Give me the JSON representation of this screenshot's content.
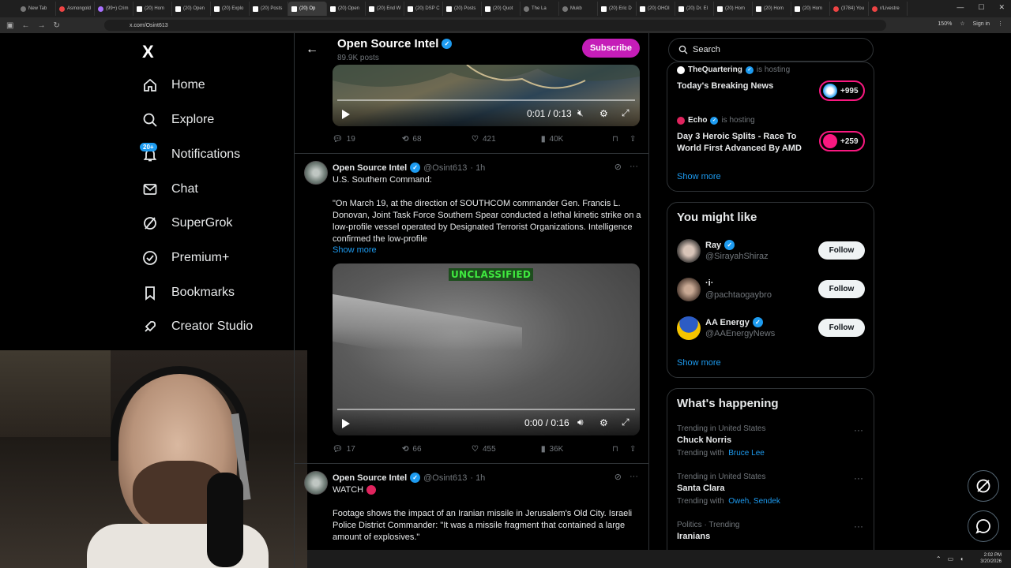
{
  "browser": {
    "tabs": [
      {
        "label": "New Tab",
        "fav": "g"
      },
      {
        "label": "Asmongold",
        "fav": "r"
      },
      {
        "label": "(99+) Crim",
        "fav": "p"
      },
      {
        "label": "(20) Hom",
        "fav": "x"
      },
      {
        "label": "(20) Open",
        "fav": "x"
      },
      {
        "label": "(20) Explo",
        "fav": "x"
      },
      {
        "label": "(20) Posts",
        "fav": "x"
      },
      {
        "label": "(20) Op",
        "fav": "x",
        "active": true
      },
      {
        "label": "(20) Open",
        "fav": "x"
      },
      {
        "label": "(20) End W",
        "fav": "x"
      },
      {
        "label": "(20) DSP C",
        "fav": "x"
      },
      {
        "label": "(20) Posts",
        "fav": "x"
      },
      {
        "label": "(20) Quot",
        "fav": "x"
      },
      {
        "label": "The La",
        "fav": "g"
      },
      {
        "label": "Mukb",
        "fav": "g"
      },
      {
        "label": "(20) Eric D",
        "fav": "x"
      },
      {
        "label": "(20) OHOI",
        "fav": "x"
      },
      {
        "label": "(20) Dr. El",
        "fav": "x"
      },
      {
        "label": "(20) Hom",
        "fav": "x"
      },
      {
        "label": "(20) Hom",
        "fav": "x"
      },
      {
        "label": "(20) Hom",
        "fav": "x"
      },
      {
        "label": "(3784) You",
        "fav": "r"
      },
      {
        "label": "r/Livestre",
        "fav": "r"
      }
    ],
    "url": "x.com/Osint613",
    "zoom": "150%",
    "signin": "Sign in"
  },
  "sidebar": {
    "logo": "X",
    "items": [
      {
        "label": "Home"
      },
      {
        "label": "Explore"
      },
      {
        "label": "Notifications"
      },
      {
        "label": "Chat"
      },
      {
        "label": "SuperGrok"
      },
      {
        "label": "Premium+"
      },
      {
        "label": "Bookmarks"
      },
      {
        "label": "Creator Studio"
      }
    ],
    "notif_badge": "20+"
  },
  "profile_header": {
    "name": "Open Source Intel",
    "posts": "89.9K posts",
    "subscribe": "Subscribe"
  },
  "video1": {
    "time": "0:01 / 0:13"
  },
  "tweet0_actions": {
    "replies": "19",
    "reposts": "68",
    "likes": "421",
    "views": "40K"
  },
  "tweet1": {
    "name": "Open Source Intel",
    "handle": "@Osint613",
    "time": "· 1h",
    "line1": "U.S. Southern Command:",
    "body": "\"On March 19, at the direction of SOUTHCOM commander Gen. Francis L. Donovan, Joint Task Force Southern Spear conducted a lethal kinetic strike on a low-profile vessel operated by Designated Terrorist Organizations. Intelligence confirmed the low-profile",
    "show_more": "Show more",
    "video_label": "UNCLASSIFIED",
    "video_time": "0:00 / 0:16",
    "replies": "17",
    "reposts": "66",
    "likes": "455",
    "views": "36K"
  },
  "tweet2": {
    "name": "Open Source Intel",
    "handle": "@Osint613",
    "time": "· 1h",
    "line1": "WATCH",
    "body": "Footage shows the impact of an Iranian missile in Jerusalem's Old City. Israeli Police District Commander: \"It was a missile fragment that contained a large amount of explosives.\""
  },
  "search": {
    "placeholder": "Search"
  },
  "spaces": {
    "items": [
      {
        "host": "TheQuartering",
        "hosting": "is hosting",
        "title": "Today's Breaking News",
        "count": "+995"
      },
      {
        "host": "Echo",
        "hosting": "is hosting",
        "title": "Day 3 Heroic Splits - Race To World First Advanced By AMD",
        "count": "+259"
      }
    ],
    "show_more": "Show more"
  },
  "who_to_follow": {
    "title": "You might like",
    "users": [
      {
        "name": "Ray",
        "handle": "@SirayahShiraz",
        "follow": "Follow"
      },
      {
        "name": "·i·",
        "handle": "@pachtaogaybro",
        "follow": "Follow"
      },
      {
        "name": "AA Energy",
        "handle": "@AAEnergyNews",
        "follow": "Follow"
      }
    ],
    "show_more": "Show more"
  },
  "trends": {
    "title": "What's happening",
    "items": [
      {
        "context": "Trending in United States",
        "name": "Chuck Norris",
        "with_label": "Trending with",
        "with": "Bruce Lee"
      },
      {
        "context": "Trending in United States",
        "name": "Santa Clara",
        "with_label": "Trending with",
        "with": "Oweh, Sendek"
      },
      {
        "context": "Politics · Trending",
        "name": "Iranians",
        "with_label": "",
        "with": ""
      }
    ]
  },
  "taskbar": {
    "time": "2:02 PM",
    "date": "3/20/2026"
  }
}
